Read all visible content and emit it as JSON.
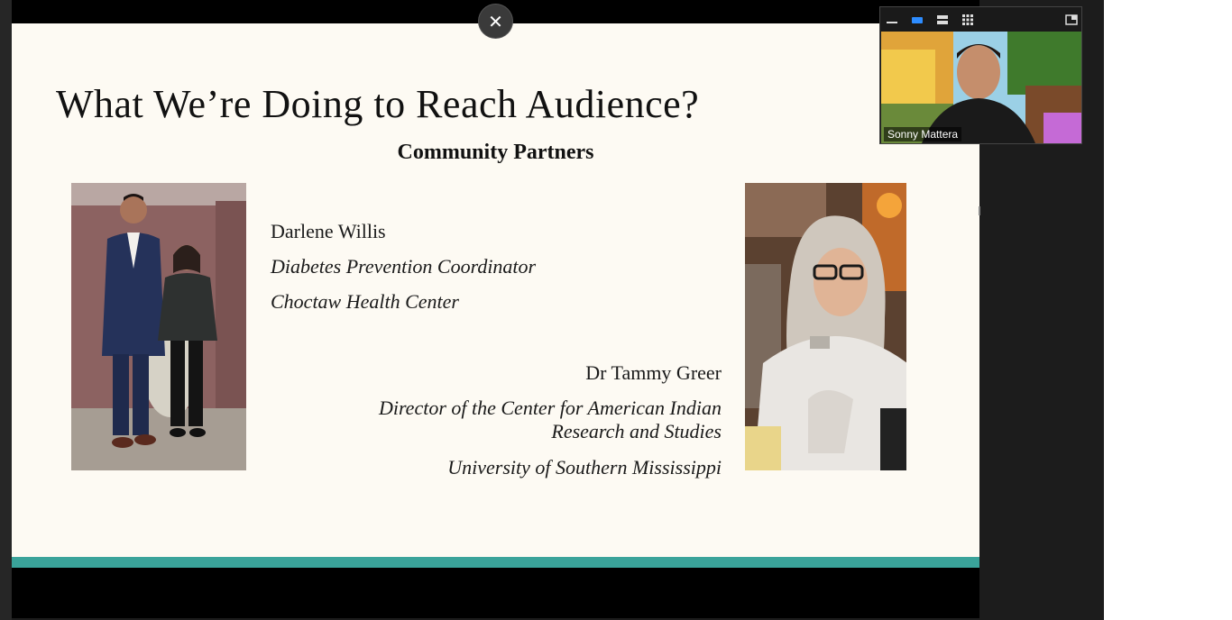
{
  "slide": {
    "title": "What We’re Doing to Reach Audience?",
    "subtitle": "Community Partners",
    "partner1": {
      "name": "Darlene Willis",
      "role": "Diabetes Prevention Coordinator",
      "org": "Choctaw Health Center"
    },
    "partner2": {
      "name": "Dr Tammy Greer",
      "role_line1": "Director of the Center for American Indian",
      "role_line2": "Research and Studies",
      "org": "University of Southern Mississippi"
    }
  },
  "meeting": {
    "close_label": "✕",
    "participant_name": "Sonny Mattera"
  },
  "icons": {
    "minimize": "minimize-icon",
    "speaker_view": "speaker-view-icon",
    "strip_view": "strip-view-icon",
    "gallery_view": "gallery-view-icon",
    "pop_out": "pop-out-icon"
  },
  "colors": {
    "slide_bg": "#fdfaf3",
    "teal_accent": "#3aa39a",
    "active_view": "#2d8cff"
  }
}
